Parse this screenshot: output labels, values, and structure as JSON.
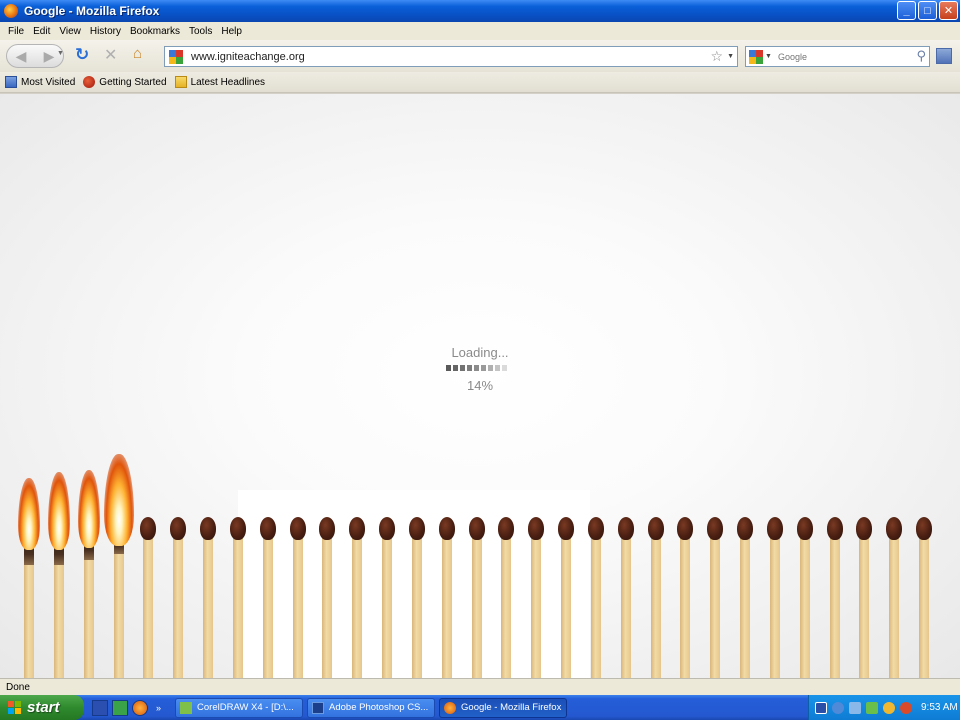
{
  "window": {
    "title": "Google - Mozilla Firefox",
    "buttons": {
      "minimize": "_",
      "maximize": "□",
      "close": "✕"
    }
  },
  "menu": [
    "File",
    "Edit",
    "View",
    "History",
    "Bookmarks",
    "Tools",
    "Help"
  ],
  "nav": {
    "url": "www.igniteachange.org",
    "search_placeholder": "Google",
    "icons": [
      "back-icon",
      "forward-icon",
      "reload-icon",
      "stop-icon",
      "home-icon",
      "bookmark-star-icon",
      "search-icon"
    ]
  },
  "bookmarks": [
    "Most Visited",
    "Getting Started",
    "Latest Headlines"
  ],
  "content": {
    "loading_text": "Loading...",
    "percent_text": "14%",
    "progress": 0.14,
    "progress_colors": [
      "#5a5a5a",
      "#666666",
      "#727272",
      "#7e7e7e",
      "#8c8c8c",
      "#9a9a9a",
      "#b0b0b0",
      "#c4c4c4",
      "#dadada"
    ],
    "matches_total": 31,
    "matches_lit": 4
  },
  "status": "Done",
  "taskbar": {
    "start_label": "start",
    "tasks": [
      {
        "label": "CorelDRAW X4 - [D:\\...",
        "icon": "coreldraw-icon"
      },
      {
        "label": "Adobe Photoshop CS...",
        "icon": "photoshop-icon"
      },
      {
        "label": "Google - Mozilla Firefox",
        "icon": "firefox-icon"
      }
    ],
    "quicklaunch_more": "»",
    "clock": "9:53 AM"
  },
  "colors": {
    "titlebar": "#0a5fd8",
    "match_head": "#4a1f12",
    "match_stick": "#f2dba5",
    "flame": "#ffb333"
  }
}
